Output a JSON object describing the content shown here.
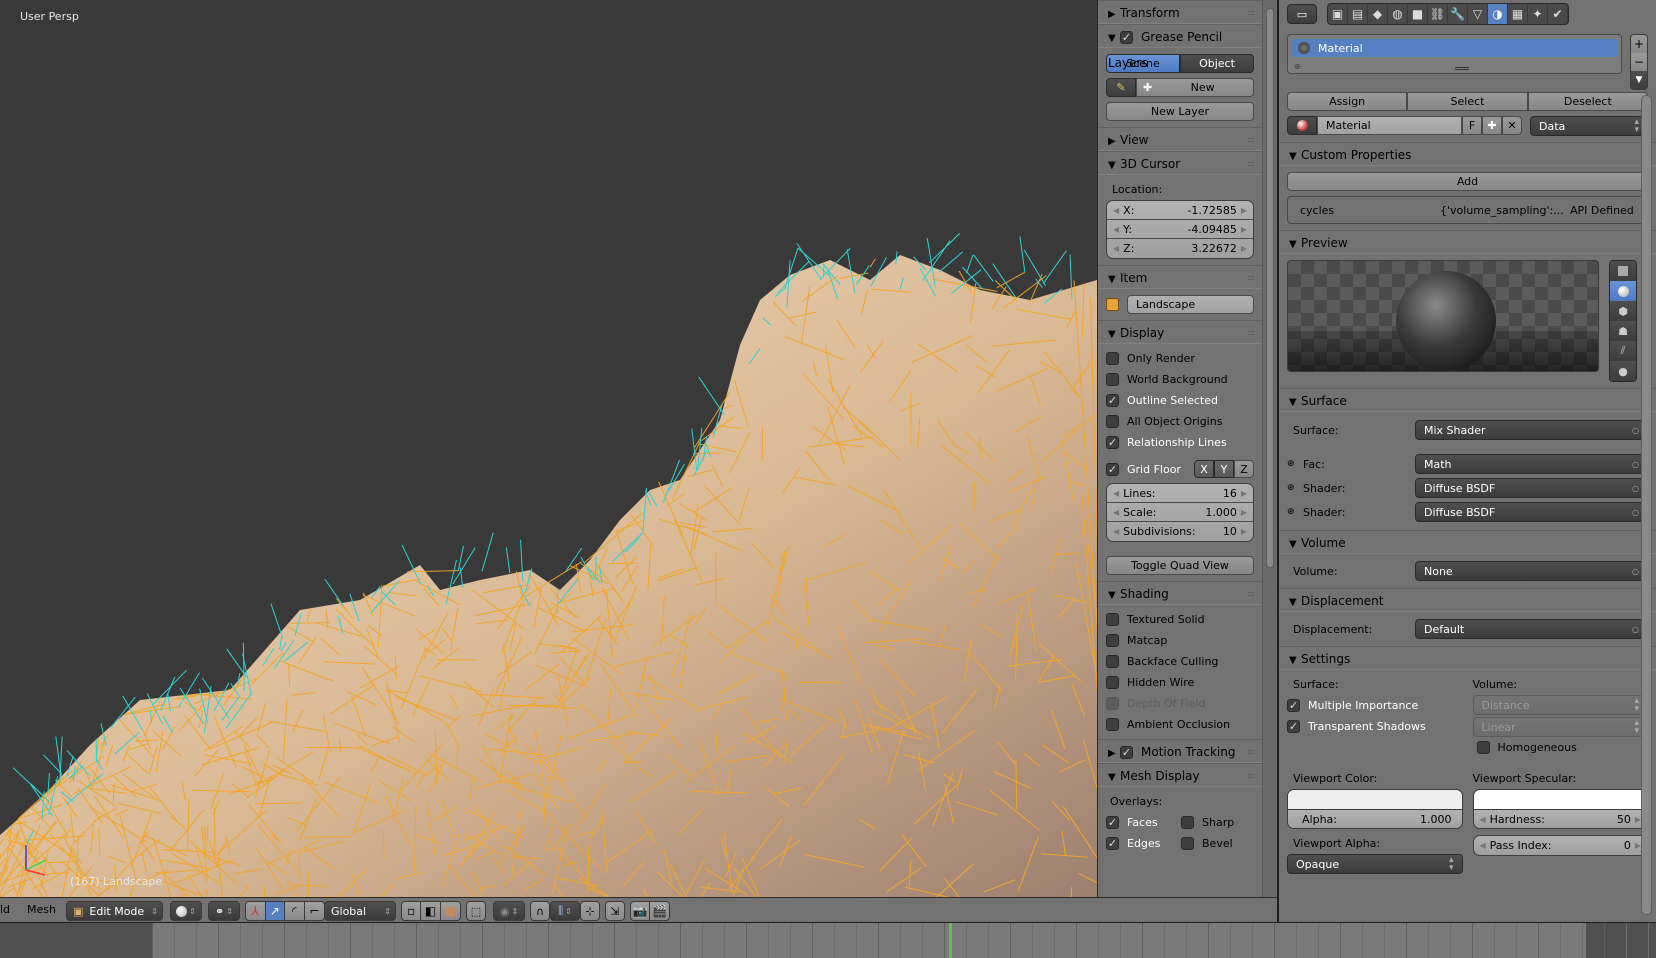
{
  "viewport": {
    "view_label": "User Persp",
    "object_label": "(167) Landscape",
    "colors": {
      "background": "#393939",
      "wire": "#f5a623",
      "normals": "#2fd3d3",
      "surface": "#e9c9a6"
    }
  },
  "npanel": {
    "transform": {
      "title": "Transform"
    },
    "grease_pencil": {
      "title": "Grease Pencil Layers",
      "checked": true,
      "scene_label": "Scene",
      "object_label": "Object",
      "new_label": "New",
      "new_layer_label": "New Layer"
    },
    "view": {
      "title": "View"
    },
    "cursor": {
      "title": "3D Cursor",
      "location_label": "Location:",
      "x_label": "X:",
      "x": "-1.72585",
      "y_label": "Y:",
      "y": "-4.09485",
      "z_label": "Z:",
      "z": "3.22672"
    },
    "item": {
      "title": "Item",
      "name": "Landscape"
    },
    "display": {
      "title": "Display",
      "options": [
        {
          "label": "Only Render",
          "checked": false
        },
        {
          "label": "World Background",
          "checked": false
        },
        {
          "label": "Outline Selected",
          "checked": true
        },
        {
          "label": "All Object Origins",
          "checked": false
        },
        {
          "label": "Relationship Lines",
          "checked": true
        }
      ],
      "grid_floor": {
        "label": "Grid Floor",
        "checked": true,
        "x": "X",
        "y": "Y",
        "z": "Z"
      },
      "lines_label": "Lines:",
      "lines": "16",
      "scale_label": "Scale:",
      "scale": "1.000",
      "subdiv_label": "Subdivisions:",
      "subdiv": "10",
      "toggle_quad": "Toggle Quad View"
    },
    "shading": {
      "title": "Shading",
      "options": [
        {
          "label": "Textured Solid",
          "checked": false
        },
        {
          "label": "Matcap",
          "checked": false
        },
        {
          "label": "Backface Culling",
          "checked": false
        },
        {
          "label": "Hidden Wire",
          "checked": false
        },
        {
          "label": "Depth Of Field",
          "checked": false,
          "disabled": true
        },
        {
          "label": "Ambient Occlusion",
          "checked": false
        }
      ]
    },
    "motion_tracking": {
      "title": "Motion Tracking",
      "checked": true
    },
    "mesh_display": {
      "title": "Mesh Display",
      "overlays_label": "Overlays:",
      "faces": "Faces",
      "sharp": "Sharp",
      "edges": "Edges",
      "bevel": "Bevel"
    }
  },
  "properties": {
    "tabs": [
      "render",
      "render-layers",
      "scene",
      "world",
      "object",
      "constraints",
      "modifiers",
      "data",
      "material",
      "texture",
      "particles",
      "physics"
    ],
    "active_tab": "material",
    "slot": {
      "name": "Material"
    },
    "assign": "Assign",
    "select": "Select",
    "deselect": "Deselect",
    "material_field": "Material",
    "fake_user": "F",
    "link": "Data",
    "custom_props": {
      "title": "Custom Properties",
      "add": "Add",
      "key": "cycles",
      "value": "{'volume_sampling':...",
      "note": "API Defined"
    },
    "preview": {
      "title": "Preview"
    },
    "surface": {
      "title": "Surface",
      "surface_label": "Surface:",
      "surface_value": "Mix Shader",
      "fac_label": "Fac:",
      "fac_value": "Math",
      "shader1_label": "Shader:",
      "shader1_value": "Diffuse BSDF",
      "shader2_label": "Shader:",
      "shader2_value": "Diffuse BSDF"
    },
    "volume": {
      "title": "Volume",
      "label": "Volume:",
      "value": "None"
    },
    "displacement": {
      "title": "Displacement",
      "label": "Displacement:",
      "value": "Default"
    },
    "settings": {
      "title": "Settings",
      "surface_label": "Surface:",
      "volume_label": "Volume:",
      "multiple_importance": "Multiple Importance",
      "transparent_shadows": "Transparent Shadows",
      "volume_sampling": "Distance",
      "volume_interp": "Linear",
      "homogeneous": "Homogeneous",
      "viewport_color_label": "Viewport Color:",
      "viewport_specular_label": "Viewport Specular:",
      "alpha_label": "Alpha:",
      "alpha": "1.000",
      "hardness_label": "Hardness:",
      "hardness": "50",
      "viewport_alpha_label": "Viewport Alpha:",
      "viewport_alpha": "Opaque",
      "pass_index_label": "Pass Index:",
      "pass_index": "0",
      "viewport_color": "#eeeeee",
      "viewport_specular": "#ffffff"
    }
  },
  "header": {
    "menu_partial": "ld",
    "mesh_menu": "Mesh",
    "mode": "Edit Mode",
    "orientation": "Global"
  },
  "timeline": {
    "current_frame_color": "#5fc24a"
  }
}
